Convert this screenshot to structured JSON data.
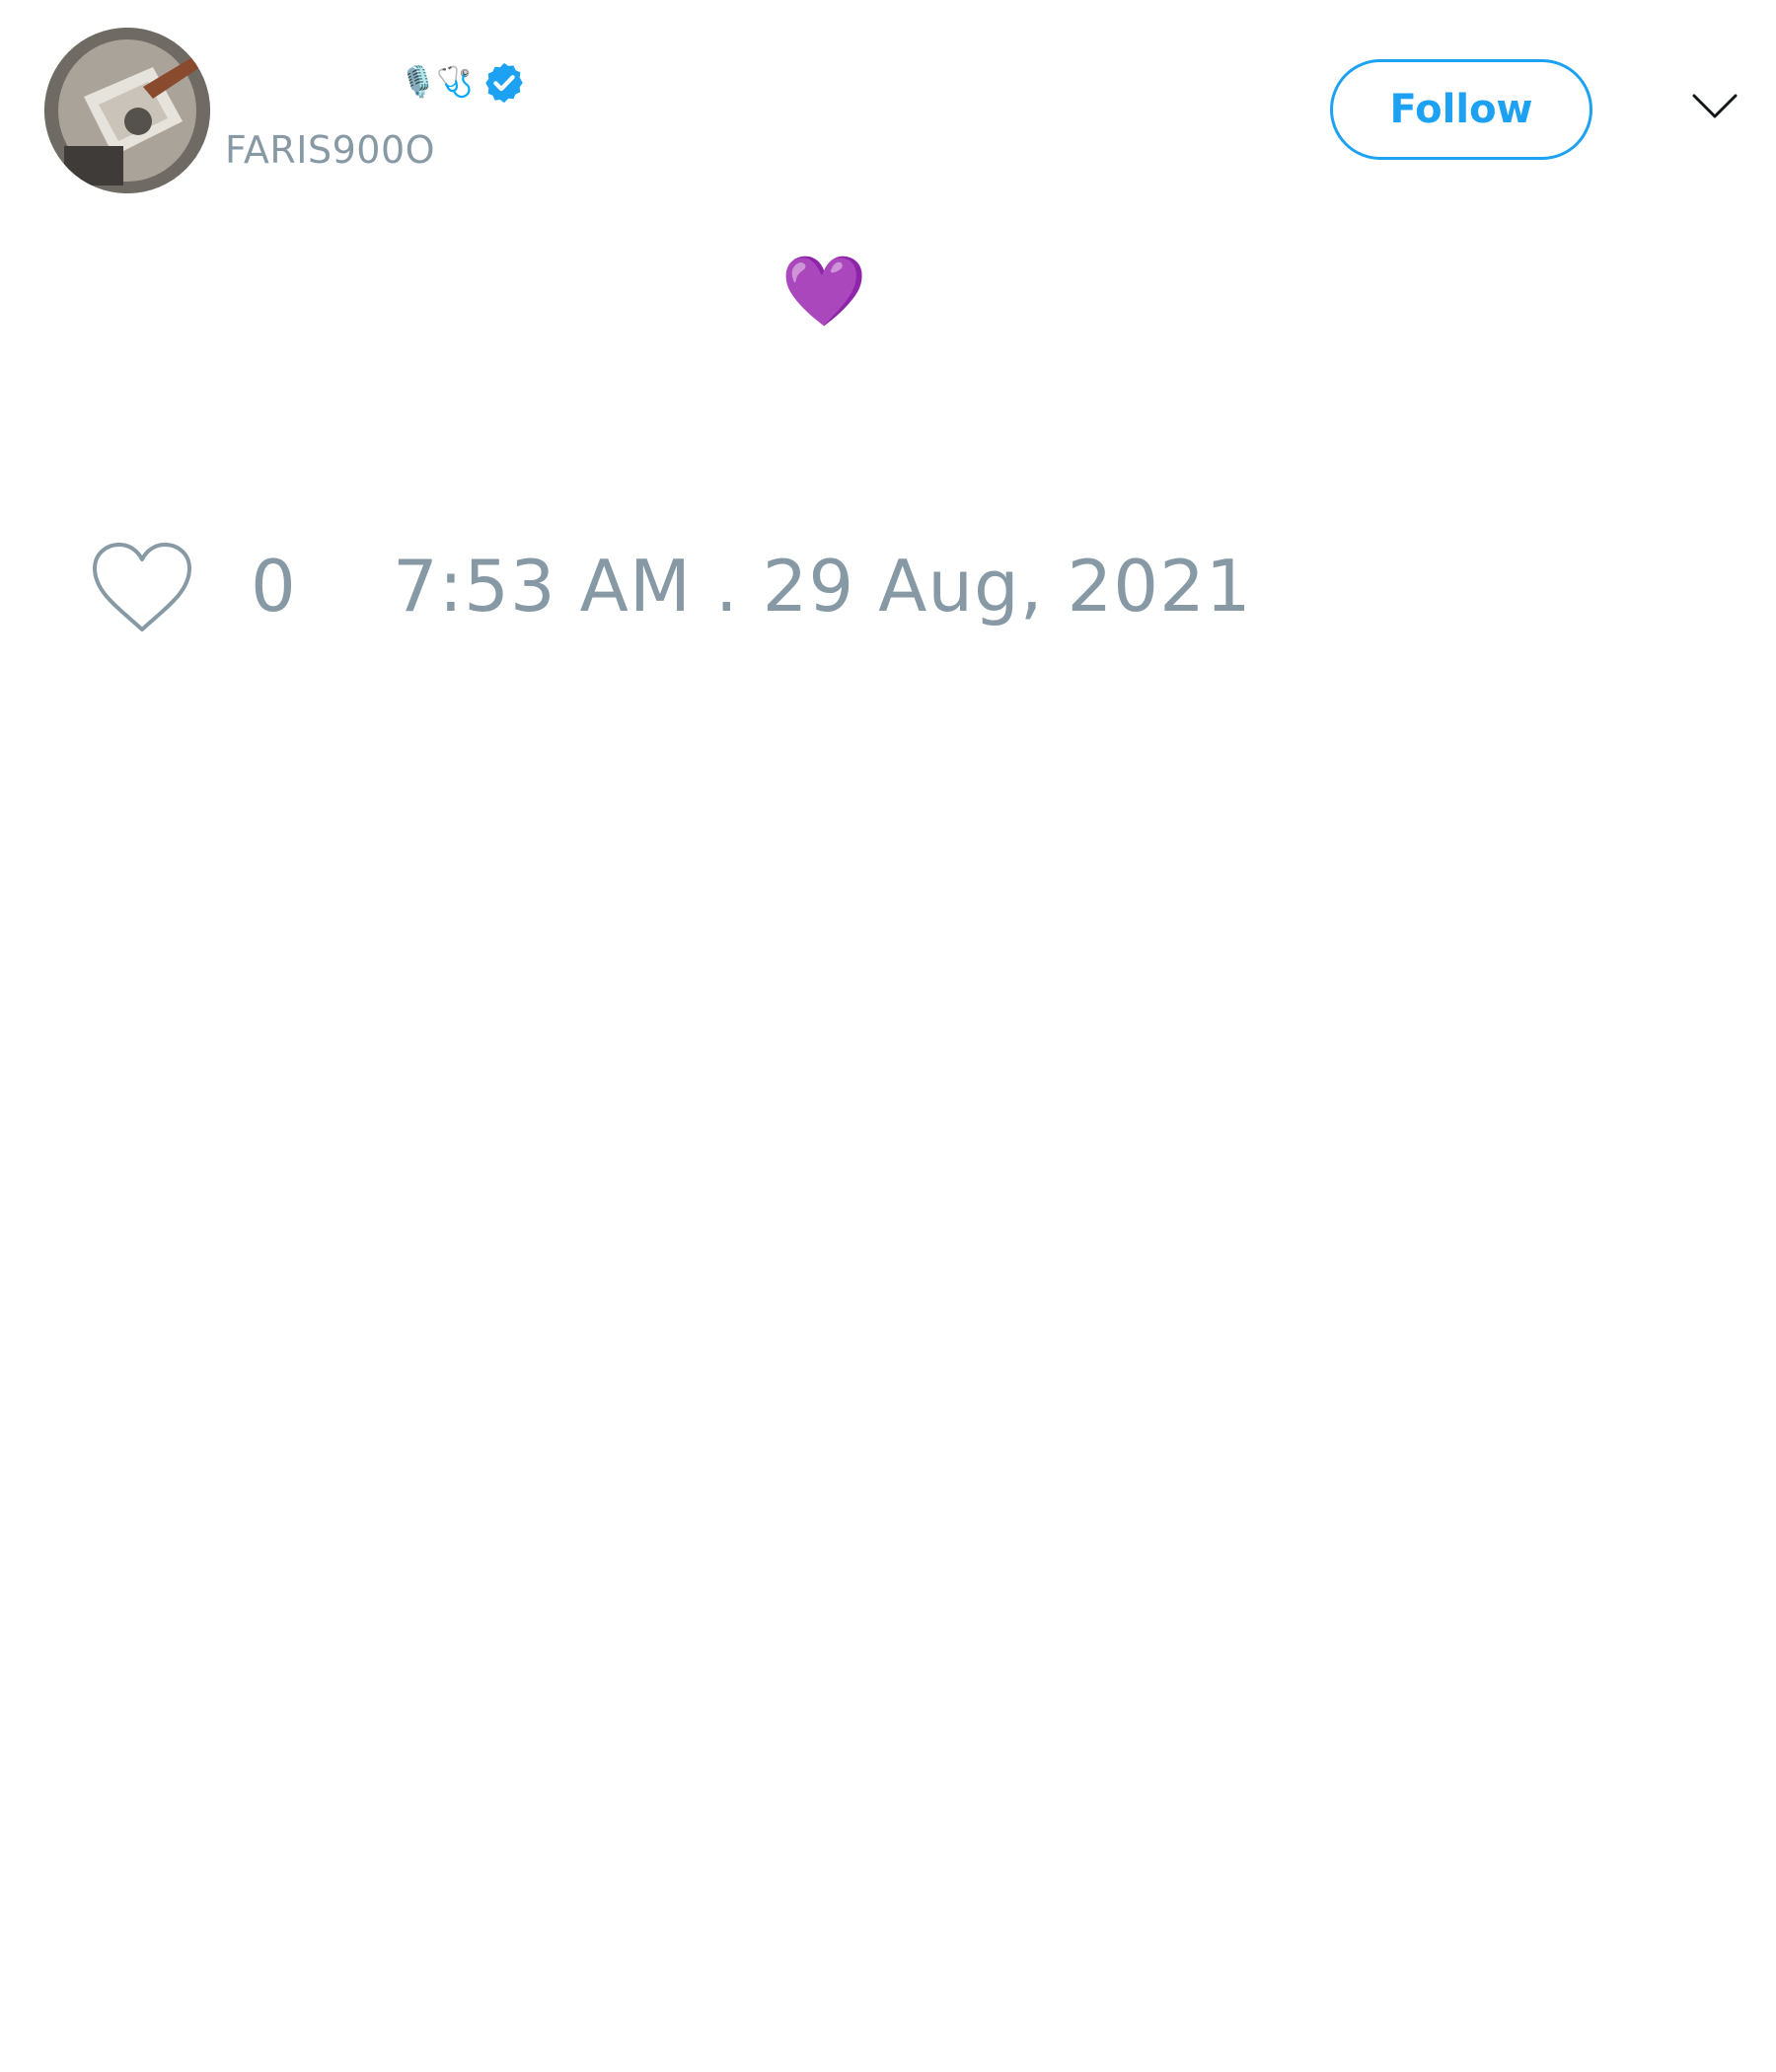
{
  "user": {
    "name_emoji": "🎙️🩺",
    "handle": "FARIS900O",
    "verified": true,
    "avatar_icon": "avatar-photo"
  },
  "header": {
    "follow_label": "Follow",
    "menu_icon": "chevron-down-icon"
  },
  "tweet": {
    "text": "💜"
  },
  "footer": {
    "like_icon": "heart-outline-icon",
    "like_count": "0",
    "timestamp": "7:53 AM . 29 Aug, 2021"
  },
  "colors": {
    "accent": "#1da1f2",
    "muted_text": "#8899a6",
    "heart": "#8e44ad"
  }
}
